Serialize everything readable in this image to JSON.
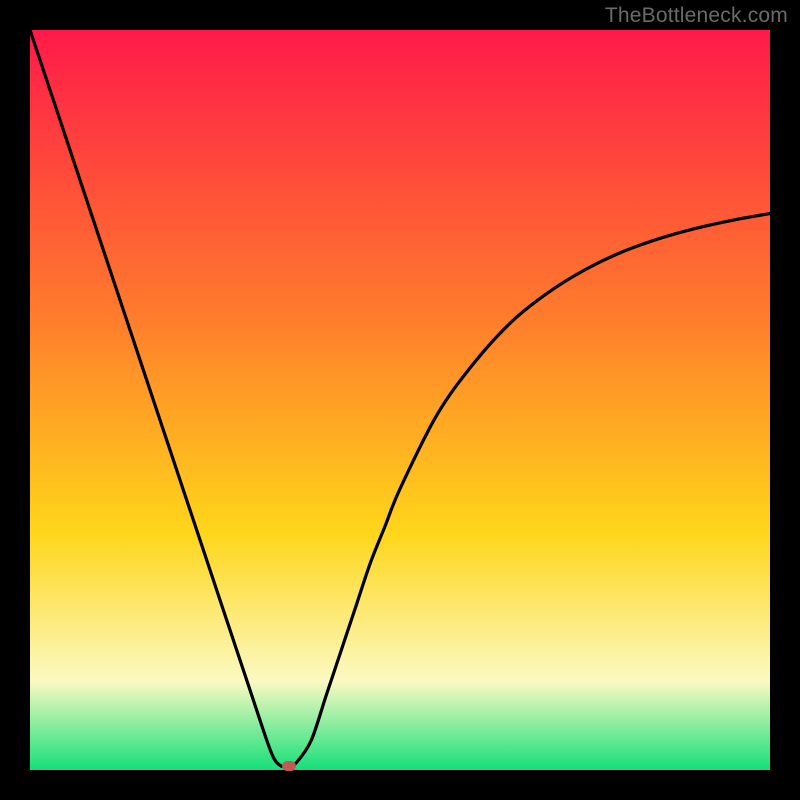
{
  "watermark": "TheBottleneck.com",
  "colors": {
    "top": "#ff1a49",
    "mid1": "#ff7a2d",
    "mid2": "#ffd61a",
    "pale": "#fbf9c2",
    "bottom": "#14e07a",
    "curve": "#000000",
    "marker": "#c35a52",
    "frame": "#000000"
  },
  "chart_data": {
    "type": "line",
    "title": "",
    "xlabel": "",
    "ylabel": "",
    "xlim": [
      0,
      100
    ],
    "ylim": [
      0,
      100
    ],
    "x": [
      0,
      2,
      4,
      6,
      8,
      10,
      12,
      14,
      16,
      18,
      20,
      22,
      24,
      26,
      28,
      30,
      32,
      33,
      34,
      35,
      36,
      38,
      40,
      42,
      44,
      46,
      48,
      50,
      55,
      60,
      65,
      70,
      75,
      80,
      85,
      90,
      95,
      100
    ],
    "values": [
      100,
      94,
      88,
      82,
      76,
      70,
      64,
      58,
      52,
      46,
      40,
      34,
      28,
      22,
      16,
      10,
      4,
      1.5,
      0.5,
      0.5,
      1,
      4,
      10,
      16,
      22,
      28,
      33,
      38,
      48,
      55,
      60.5,
      64.5,
      67.6,
      70,
      71.8,
      73.2,
      74.3,
      75.2
    ],
    "annotations": [
      {
        "type": "marker",
        "x": 35,
        "y": 0.5
      }
    ]
  }
}
